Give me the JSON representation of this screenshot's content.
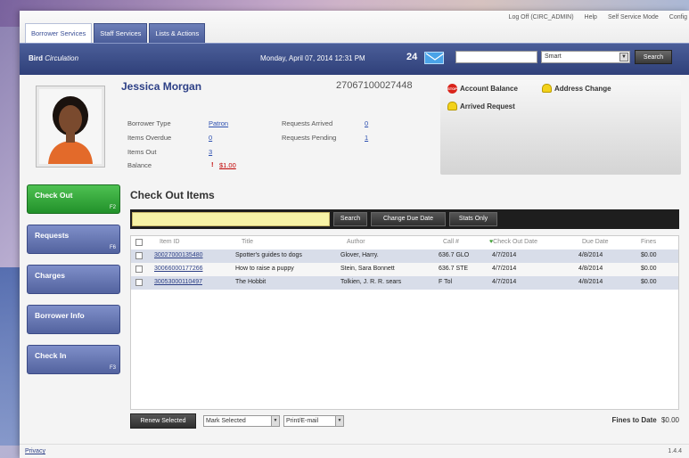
{
  "toplinks": [
    "Log Off (CIRC_ADMIN)",
    "Help",
    "Self Service Mode",
    "Config"
  ],
  "tabs": [
    {
      "label": "Borrower Services",
      "active": true
    },
    {
      "label": "Staff Services",
      "active": false
    },
    {
      "label": "Lists & Actions",
      "active": false
    }
  ],
  "titlebar": {
    "brand_bold": "Bird",
    "brand_italic": "Circulation",
    "datetime": "Monday, April 07, 2014 12:31 PM",
    "message_count": "24",
    "search_mode": "Smart",
    "search_button": "Search"
  },
  "patron": {
    "name": "Jessica Morgan",
    "barcode": "27067100027448",
    "borrower_type_label": "Borrower Type",
    "borrower_type": "Patron",
    "items_overdue_label": "Items Overdue",
    "items_overdue": "0",
    "items_out_label": "Items Out",
    "items_out": "3",
    "balance_label": "Balance",
    "balance_flag": "!",
    "balance": "$1.00",
    "requests_arrived_label": "Requests Arrived",
    "requests_arrived": "0",
    "requests_pending_label": "Requests Pending",
    "requests_pending": "1"
  },
  "alerts": {
    "account_balance": "Account Balance",
    "stop_text": "STOP",
    "address_change": "Address Change",
    "arrived_request": "Arrived Request"
  },
  "nav": [
    {
      "label": "Check Out",
      "key": "F2",
      "active": true
    },
    {
      "label": "Requests",
      "key": "F6",
      "active": false
    },
    {
      "label": "Charges",
      "key": "",
      "active": false
    },
    {
      "label": "Borrower Info",
      "key": "",
      "active": false
    },
    {
      "label": "Check In",
      "key": "F3",
      "active": false
    }
  ],
  "checkout": {
    "title": "Check Out Items",
    "search_button": "Search",
    "change_due_button": "Change Due Date",
    "stats_only_button": "Stats Only",
    "columns": [
      "Item ID",
      "Title",
      "Author",
      "Call #",
      "Check Out Date",
      "Due Date",
      "Fines"
    ],
    "rows": [
      {
        "id": "30027000135480",
        "title": "Spotter's guides to dogs",
        "author": "Glover, Harry.",
        "call": "636.7 GLO",
        "checkout": "4/7/2014",
        "due": "4/8/2014",
        "fines": "$0.00"
      },
      {
        "id": "30066000177266",
        "title": "How to raise a puppy",
        "author": "Stein, Sara Bonnett",
        "call": "636.7 STE",
        "checkout": "4/7/2014",
        "due": "4/8/2014",
        "fines": "$0.00"
      },
      {
        "id": "30053000110497",
        "title": "The Hobbit",
        "author": "Tolkien, J. R. R. sears",
        "call": "F Tol",
        "checkout": "4/7/2014",
        "due": "4/8/2014",
        "fines": "$0.00"
      }
    ],
    "renew_button": "Renew Selected",
    "mark_selected": "Mark Selected",
    "print_email": "Print/E-mail",
    "fines_to_date_label": "Fines to Date",
    "fines_to_date": "$0.00"
  },
  "footer": {
    "privacy": "Privacy",
    "version": "1.4.4"
  }
}
